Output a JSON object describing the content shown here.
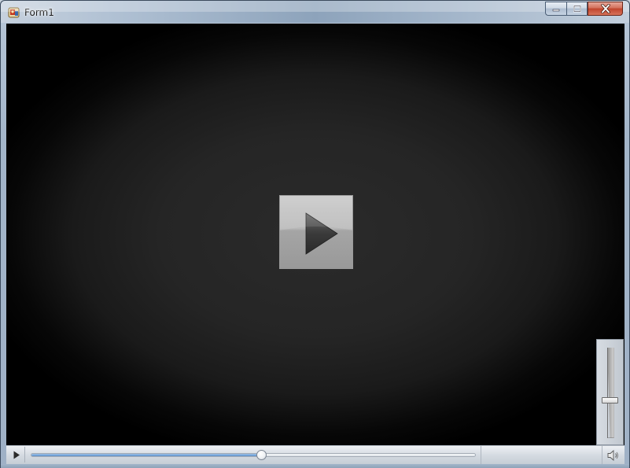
{
  "window": {
    "title": "Form1",
    "app_icon": "form-app-icon",
    "caption_buttons": [
      {
        "name": "minimize",
        "icon": "minimize-icon"
      },
      {
        "name": "maximize",
        "icon": "maximize-icon"
      },
      {
        "name": "close",
        "icon": "close-icon"
      }
    ]
  },
  "player": {
    "overlay_icon": "play-icon",
    "seek_position_fraction": 0.52,
    "volume_level_fraction": 0.42,
    "controls": {
      "play_icon": "play-icon",
      "mute_icon": "speaker-icon"
    }
  },
  "colors": {
    "accent_seek": "#5b8fc8",
    "close_button": "#c0432b",
    "video_background": "#000000"
  }
}
